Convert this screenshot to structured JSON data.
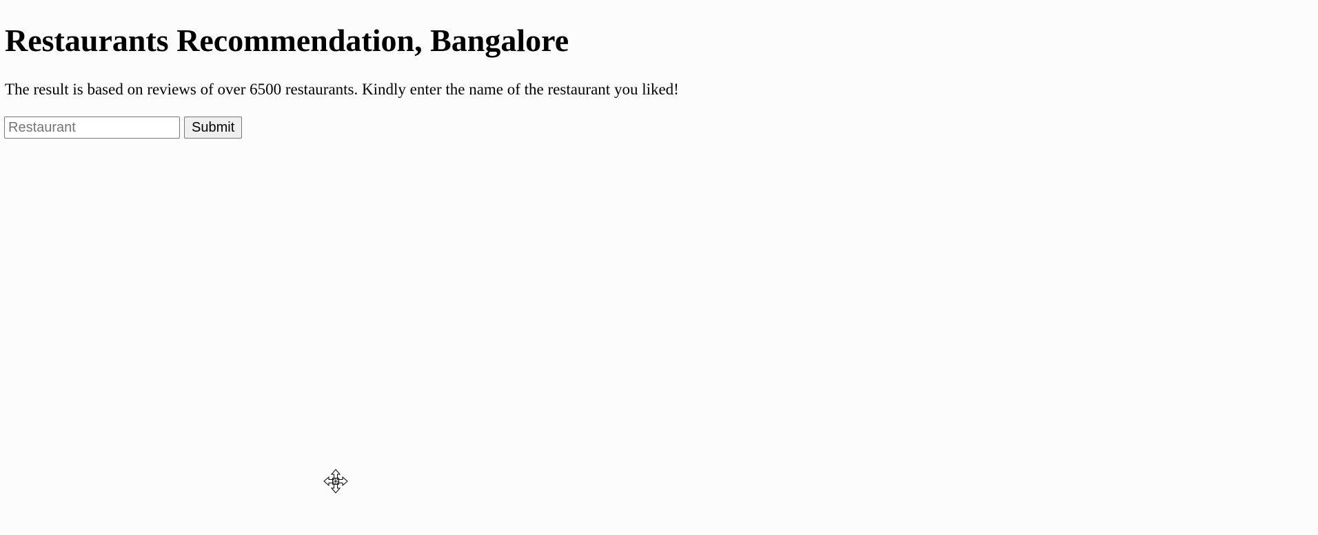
{
  "page": {
    "title": "Restaurants Recommendation, Bangalore",
    "description": "The result is based on reviews of over 6500 restaurants. Kindly enter the name of the restaurant you liked!"
  },
  "form": {
    "input_value": "",
    "input_placeholder": "Restaurant",
    "submit_label": "Submit"
  },
  "colors": {
    "background": "#fcfcfd",
    "text": "#000000",
    "button_bg": "#efefef",
    "border": "#767676"
  },
  "icons": {
    "cursor": "move-cursor-icon"
  }
}
